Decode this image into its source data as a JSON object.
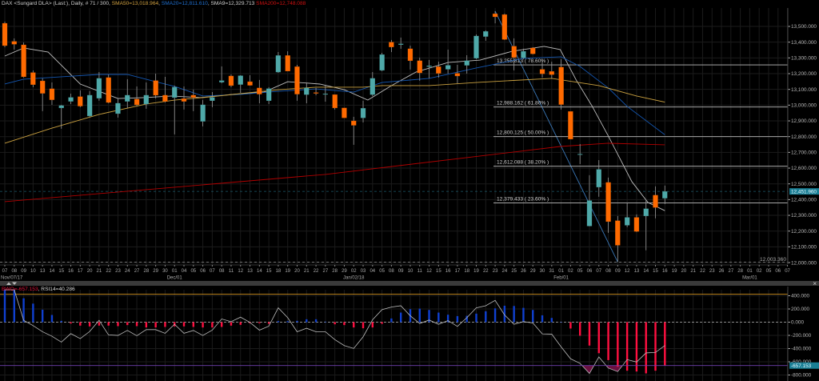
{
  "header": {
    "instrument": "DAX <Sungard DLA> (Last:), Daily, # 71 / 300, ",
    "sma50": "SMA50=13,018.964",
    "sma20": "SMA20=12,811.610",
    "sma9": "SMA9=12,329.713",
    "sma200": "SMA200=12,748.088"
  },
  "subpane": {
    "bwo": "BWO=-657.153",
    "rsi": ", RSI14=40.286"
  },
  "colors": {
    "up": "#4fa9a9",
    "down": "#ff6a00",
    "sma50": "#c9a040",
    "sma20": "#1456b0",
    "sma9": "#bdbdbd",
    "sma200": "#b00000",
    "fib_trend": "#3a78b8",
    "bar_pos": "#1040d0",
    "bar_neg": "#ff1040",
    "last_price": "#1a7f95",
    "upper_level": "#d09020",
    "lower_level": "#7040b0",
    "oversold_fill": "#6a1040"
  },
  "chart_data": [
    {
      "type": "candlestick",
      "title": "DAX <Sungard DLA> (Last:), Daily",
      "ylim": [
        12000,
        13550
      ],
      "y_ticks": [
        "12,000.000",
        "12,100.000",
        "12,200.000",
        "12,300.000",
        "12,400.000",
        "12,500.000",
        "12,600.000",
        "12,700.000",
        "12,800.000",
        "12,900.000",
        "13,000.000",
        "13,100.000",
        "13,200.000",
        "13,300.000",
        "13,400.000",
        "13,500.000"
      ],
      "y_tick_values": [
        12000,
        12100,
        12200,
        12300,
        12400,
        12500,
        12600,
        12700,
        12800,
        12900,
        13000,
        13100,
        13200,
        13300,
        13400,
        13500
      ],
      "x_day_labels": [
        "07",
        "08",
        "09",
        "10",
        "13",
        "14",
        "15",
        "16",
        "17",
        "20",
        "21",
        "22",
        "23",
        "24",
        "27",
        "28",
        "29",
        "30",
        "01",
        "04",
        "05",
        "06",
        "07",
        "08",
        "11",
        "12",
        "13",
        "14",
        "15",
        "18",
        "19",
        "20",
        "21",
        "22",
        "27",
        "28",
        "29",
        "02",
        "03",
        "04",
        "05",
        "08",
        "09",
        "10",
        "11",
        "12",
        "15",
        "16",
        "17",
        "18",
        "19",
        "22",
        "23",
        "24",
        "25",
        "26",
        "29",
        "30",
        "31",
        "01",
        "02",
        "05",
        "06",
        "07",
        "08",
        "09",
        "12",
        "13",
        "14",
        "15",
        "16",
        "19",
        "20",
        "21",
        "22",
        "23",
        "26",
        "27",
        "28",
        "01",
        "02",
        "05",
        "06",
        "07"
      ],
      "x_month_labels": [
        {
          "index": 0,
          "label": "Nov/07/17"
        },
        {
          "index": 18,
          "label": "Dec/01"
        },
        {
          "index": 37,
          "label": "Jan/02/18"
        },
        {
          "index": 59,
          "label": "Feb/01"
        },
        {
          "index": 79,
          "label": "Mar/01"
        }
      ],
      "ohlc_fields": [
        "open",
        "high",
        "low",
        "close"
      ],
      "candles": [
        [
          13520,
          13530,
          13368,
          13378
        ],
        [
          13405,
          13424,
          13353,
          13387
        ],
        [
          13383,
          13398,
          13175,
          13180
        ],
        [
          13207,
          13220,
          13114,
          13130
        ],
        [
          13154,
          13170,
          12962,
          13075
        ],
        [
          13104,
          13144,
          13002,
          13034
        ],
        [
          12982,
          13002,
          12850,
          12997
        ],
        [
          13024,
          13073,
          13007,
          13049
        ],
        [
          13054,
          13094,
          12987,
          12994
        ],
        [
          12931,
          13089,
          12926,
          13063
        ],
        [
          13044,
          13210,
          13028,
          13170
        ],
        [
          13175,
          13195,
          13012,
          13017
        ],
        [
          12946,
          13043,
          12921,
          13012
        ],
        [
          13024,
          13165,
          12982,
          13063
        ],
        [
          13038,
          13119,
          12997,
          13002
        ],
        [
          13007,
          13144,
          12977,
          13063
        ],
        [
          13156,
          13200,
          13043,
          13063
        ],
        [
          13063,
          13180,
          13017,
          13024
        ],
        [
          13048,
          13124,
          12814,
          13114
        ],
        [
          13041,
          13119,
          12972,
          13024
        ],
        [
          13063,
          13099,
          12962,
          13048
        ],
        [
          12897,
          13033,
          12865,
          13002
        ],
        [
          13028,
          13083,
          12987,
          13049
        ],
        [
          13146,
          13246,
          13139,
          13156
        ],
        [
          13185,
          13195,
          13114,
          13124
        ],
        [
          13131,
          13190,
          13078,
          13187
        ],
        [
          13149,
          13190,
          13124,
          13126
        ],
        [
          13109,
          13160,
          13012,
          13070
        ],
        [
          13028,
          13114,
          13007,
          13105
        ],
        [
          13210,
          13337,
          13205,
          13315
        ],
        [
          13315,
          13342,
          13216,
          13216
        ],
        [
          13244,
          13256,
          13028,
          13070
        ],
        [
          13067,
          13139,
          13012,
          13109
        ],
        [
          13080,
          13109,
          13063,
          13075
        ],
        [
          13072,
          13124,
          13022,
          13072
        ],
        [
          13067,
          13068,
          12972,
          12982
        ],
        [
          12982,
          12982,
          12921,
          12919
        ],
        [
          12900,
          12926,
          12748,
          12872
        ],
        [
          12919,
          13028,
          12890,
          12980
        ],
        [
          13067,
          13210,
          13058,
          13170
        ],
        [
          13221,
          13332,
          13216,
          13321
        ],
        [
          13400,
          13414,
          13337,
          13369
        ],
        [
          13384,
          13429,
          13358,
          13389
        ],
        [
          13358,
          13378,
          13226,
          13282
        ],
        [
          13282,
          13302,
          13155,
          13205
        ],
        [
          13245,
          13287,
          13170,
          13250
        ],
        [
          13244,
          13276,
          13175,
          13202
        ],
        [
          13228,
          13353,
          13200,
          13253
        ],
        [
          13202,
          13256,
          13139,
          13185
        ],
        [
          13253,
          13317,
          13200,
          13282
        ],
        [
          13298,
          13449,
          13292,
          13439
        ],
        [
          13436,
          13475,
          13409,
          13468
        ],
        [
          13580,
          13597,
          13520,
          13561
        ],
        [
          13575,
          13581,
          13414,
          13417
        ],
        [
          13374,
          13424,
          13221,
          13303
        ],
        [
          13300,
          13358,
          13292,
          13342
        ],
        [
          13363,
          13368,
          13322,
          13326
        ],
        [
          13227,
          13292,
          13175,
          13199
        ],
        [
          13214,
          13276,
          13170,
          13194
        ],
        [
          13241,
          13292,
          12972,
          13004
        ],
        [
          12960,
          12960,
          12784,
          12784
        ],
        [
          12689,
          12753,
          12626,
          12689
        ],
        [
          12232,
          12555,
          12230,
          12394
        ],
        [
          12479,
          12651,
          12418,
          12592
        ],
        [
          12509,
          12540,
          12189,
          12260
        ],
        [
          12266,
          12296,
          12003.36,
          12110
        ],
        [
          12237,
          12382,
          12225,
          12287
        ],
        [
          12287,
          12306,
          12194,
          12198
        ],
        [
          12296,
          12398,
          12078,
          12342
        ],
        [
          12428,
          12484,
          12281,
          12350
        ],
        [
          12409,
          12489,
          12372,
          12451.96
        ]
      ],
      "moving_averages": [
        {
          "name": "SMA9",
          "color_key": "sma9",
          "points": [
            [
              0,
              13312
            ],
            [
              2,
              13363
            ],
            [
              4.6,
              13337
            ],
            [
              8,
              13134
            ],
            [
              12,
              13042
            ],
            [
              14.8,
              13048
            ],
            [
              17.7,
              13058
            ],
            [
              20.7,
              13048
            ],
            [
              24.1,
              13068
            ],
            [
              27.5,
              13083
            ],
            [
              30,
              13149
            ],
            [
              33.4,
              13134
            ],
            [
              36,
              13098
            ],
            [
              38.5,
              13032
            ],
            [
              41,
              13124
            ],
            [
              43.6,
              13210
            ],
            [
              47,
              13271
            ],
            [
              50.4,
              13286
            ],
            [
              53.8,
              13342
            ],
            [
              57.2,
              13373
            ],
            [
              58.9,
              13353
            ],
            [
              60.6,
              13159
            ],
            [
              62.3,
              12992
            ],
            [
              64,
              12804
            ],
            [
              66.5,
              12514
            ],
            [
              68.2,
              12382
            ],
            [
              70,
              12329.713
            ]
          ]
        },
        {
          "name": "SMA20",
          "color_key": "sma20",
          "points": [
            [
              0,
              13134
            ],
            [
              2,
              13165
            ],
            [
              6,
              13180
            ],
            [
              10,
              13195
            ],
            [
              13,
              13195
            ],
            [
              16,
              13149
            ],
            [
              18,
              13119
            ],
            [
              21,
              13058
            ],
            [
              25,
              13068
            ],
            [
              29,
              13088
            ],
            [
              33,
              13103
            ],
            [
              37,
              13083
            ],
            [
              40,
              13144
            ],
            [
              45,
              13170
            ],
            [
              50,
              13236
            ],
            [
              55,
              13297
            ],
            [
              59,
              13307
            ],
            [
              61,
              13246
            ],
            [
              64,
              13109
            ],
            [
              66,
              12992
            ],
            [
              70,
              12811.61
            ]
          ]
        },
        {
          "name": "SMA50",
          "color_key": "sma50",
          "points": [
            [
              0,
              12758
            ],
            [
              5,
              12854
            ],
            [
              10,
              12941
            ],
            [
              15,
              13007
            ],
            [
              18,
              13032
            ],
            [
              21,
              13048
            ],
            [
              25,
              13073
            ],
            [
              29,
              13098
            ],
            [
              33,
              13114
            ],
            [
              38,
              13114
            ],
            [
              40,
              13124
            ],
            [
              45,
              13124
            ],
            [
              50,
              13144
            ],
            [
              58,
              13170
            ],
            [
              63,
              13124
            ],
            [
              67,
              13058
            ],
            [
              70,
              13018.964
            ]
          ]
        },
        {
          "name": "SMA200",
          "color_key": "sma200",
          "points": [
            [
              0,
              12387
            ],
            [
              34,
              12560
            ],
            [
              59,
              12738
            ],
            [
              64,
              12758
            ],
            [
              70,
              12748.088
            ]
          ]
        }
      ],
      "fibonacci": {
        "high": {
          "index": 52,
          "price": 13596.89
        },
        "low": {
          "index": 65,
          "price": 12003.36
        },
        "levels": [
          {
            "price": 13255.813,
            "label": "13,255.813 ( 78.60% )"
          },
          {
            "price": 12988.162,
            "label": "12,988.162 ( 61.80% )"
          },
          {
            "price": 12800.125,
            "label": "12,800.125 ( 50.00% )"
          },
          {
            "price": 12612.088,
            "label": "12,612.088 ( 38.20% )"
          },
          {
            "price": 12379.433,
            "label": "12,379.433 ( 23.60% )"
          }
        ]
      },
      "last_price": {
        "value": 12451.96,
        "label": "12,451.960"
      },
      "low_marker": {
        "value": 12003.36,
        "label": "12,003.360"
      },
      "grid": true
    },
    {
      "type": "bar+line",
      "title": "BWO=-657.153, RSI14=40.286",
      "ylim": [
        -820,
        470
      ],
      "y_ticks": [
        "400.000",
        "200.000",
        "0.000",
        "-200.000",
        "-400.000",
        "-600.000",
        "-800.000"
      ],
      "y_tick_values": [
        400,
        200,
        0,
        -200,
        -400,
        -600,
        -800
      ],
      "upper_level": 425,
      "current_level": {
        "value": -657.153,
        "label": "-657.153"
      },
      "bwo_bars": [
        490,
        490,
        362,
        281,
        189,
        109,
        20,
        -20,
        -52,
        -64,
        -52,
        -52,
        -60,
        -44,
        -60,
        -80,
        -80,
        -72,
        -64,
        -64,
        -72,
        -80,
        -80,
        -72,
        -52,
        -40,
        -16,
        -16,
        -24,
        16,
        16,
        20,
        44,
        44,
        8,
        -32,
        -44,
        -80,
        -92,
        -80,
        -24,
        56,
        145,
        197,
        205,
        185,
        145,
        113,
        92,
        96,
        129,
        165,
        209,
        249,
        245,
        217,
        185,
        104,
        64,
        0,
        -96,
        -205,
        -354,
        -470,
        -575,
        -675,
        -735,
        -747,
        -775,
        -735,
        -657.153
      ],
      "line": [
        490,
        490,
        28,
        -52,
        -145,
        -213,
        -302,
        -173,
        -249,
        -141,
        28,
        -193,
        -201,
        -125,
        -205,
        -113,
        -113,
        -169,
        -32,
        -169,
        -125,
        -201,
        -121,
        48,
        8,
        76,
        -4,
        -121,
        -60,
        217,
        68,
        -145,
        -92,
        -145,
        -145,
        -265,
        -354,
        -398,
        -221,
        36,
        189,
        229,
        249,
        96,
        -20,
        32,
        -32,
        24,
        -64,
        68,
        217,
        249,
        330,
        109,
        -32,
        8,
        -12,
        -177,
        -181,
        -374,
        -555,
        -623,
        -776,
        -527,
        -695,
        -748,
        -567,
        -603,
        -466,
        -458,
        -354
      ],
      "grid": true
    }
  ]
}
